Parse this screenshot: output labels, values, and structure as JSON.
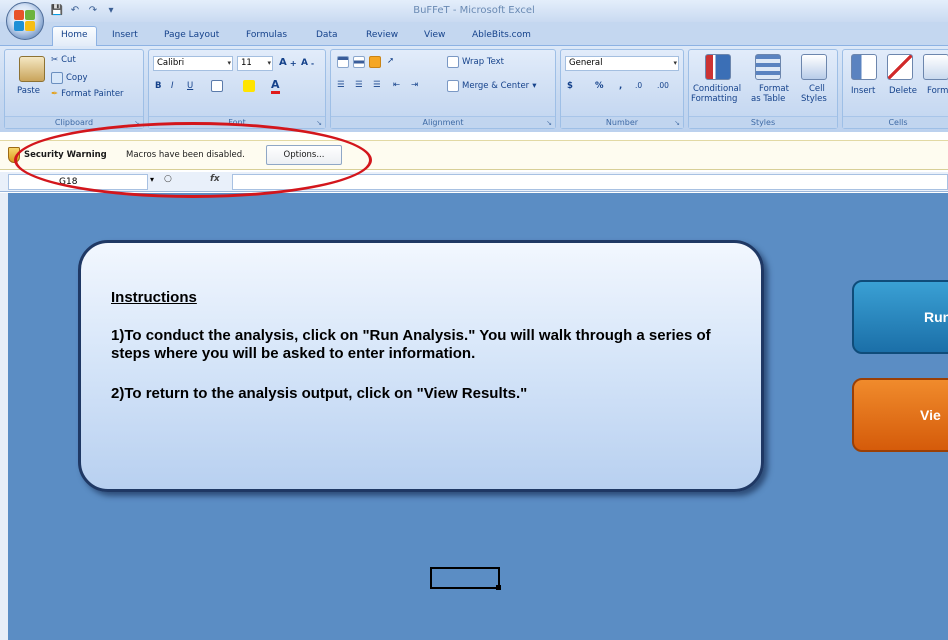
{
  "window": {
    "title": "BuFFeT - Microsoft Excel"
  },
  "office_button": {
    "icon": "office-logo-icon"
  },
  "quick_access": {
    "icons": [
      "save-icon",
      "undo-icon",
      "redo-icon",
      "customize-icon"
    ]
  },
  "tabs": [
    {
      "label": "Home",
      "active": true
    },
    {
      "label": "Insert"
    },
    {
      "label": "Page Layout"
    },
    {
      "label": "Formulas"
    },
    {
      "label": "Data"
    },
    {
      "label": "Review"
    },
    {
      "label": "View"
    },
    {
      "label": "AbleBits.com"
    }
  ],
  "ribbon": {
    "clipboard": {
      "label": "Clipboard",
      "paste": "Paste",
      "cut": "Cut",
      "copy": "Copy",
      "format_painter": "Format Painter"
    },
    "font": {
      "label": "Font",
      "font_name": "Calibri",
      "font_size": "11",
      "bold": "B",
      "italic": "I",
      "underline": "U"
    },
    "alignment": {
      "label": "Alignment",
      "wrap_text": "Wrap Text",
      "merge_center": "Merge & Center"
    },
    "number": {
      "label": "Number",
      "format": "General",
      "currency": "$",
      "percent": "%",
      "comma": ",",
      "inc_decimal": ".0",
      "dec_decimal": ".00"
    },
    "styles": {
      "label": "Styles",
      "conditional": "Conditional",
      "conditional_2": "Formatting",
      "format_table": "Format",
      "format_table_2": "as Table",
      "cell_styles": "Cell",
      "cell_styles_2": "Styles"
    },
    "cells": {
      "label": "Cells",
      "insert": "Insert",
      "delete": "Delete",
      "format": "Form"
    }
  },
  "security_bar": {
    "title": "Security Warning",
    "message": "Macros have been disabled.",
    "options_button": "Options..."
  },
  "formula_bar": {
    "name_box": "G18",
    "fx": "fx",
    "value": ""
  },
  "sheet": {
    "instructions": {
      "title": "Instructions",
      "step1": "1)To conduct the analysis, click on \"Run Analysis.\"  You will walk through a series of steps where you will be asked to enter information.",
      "step2": "2)To return to the analysis output, click on \"View Results.\""
    },
    "run_button": "Run",
    "view_button": "Vie"
  },
  "colors": {
    "sheet_background": "#5b8dc4",
    "run_button": "#1b6fa8",
    "view_button": "#d55b0a",
    "annotation": "#d3161c"
  }
}
